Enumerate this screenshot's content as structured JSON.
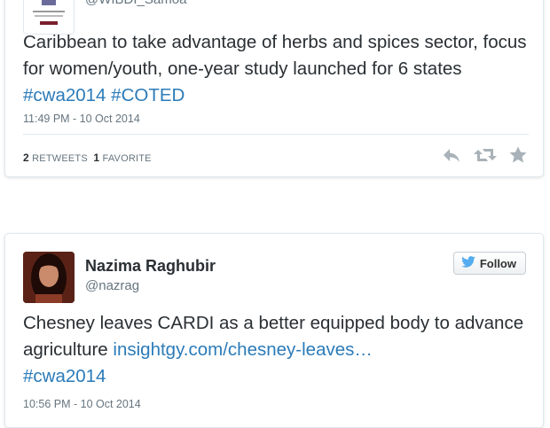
{
  "tweets": [
    {
      "handle": "@WIBDI_Samoa",
      "text_plain": "Caribbean to take advantage of herbs and spices sector, focus for women/youth, one-year study launched for 6 states ",
      "hashtag1": "#cwa2014",
      "hashtag2": "#COTED",
      "timestamp": "11:49 PM - 10 Oct 2014",
      "retweets_count": "2",
      "retweets_label": "RETWEETS",
      "favorites_count": "1",
      "favorites_label": "FAVORITE",
      "icons": [
        "reply-icon",
        "retweet-icon",
        "favorite-icon"
      ]
    },
    {
      "display_name": "Nazima Raghubir",
      "handle": "@nazrag",
      "follow_label": "Follow",
      "text_plain": "Chesney leaves CARDI as a better equipped body to advance agriculture ",
      "link": "insightgy.com/chesney-leaves…",
      "hashtag1": "#cwa2014",
      "timestamp": "10:56 PM - 10 Oct 2014"
    }
  ],
  "colors": {
    "link": "#2b7bb9",
    "text": "#292f33",
    "muted": "#66757f",
    "border": "#e1e8ed",
    "bird": "#55acee"
  }
}
